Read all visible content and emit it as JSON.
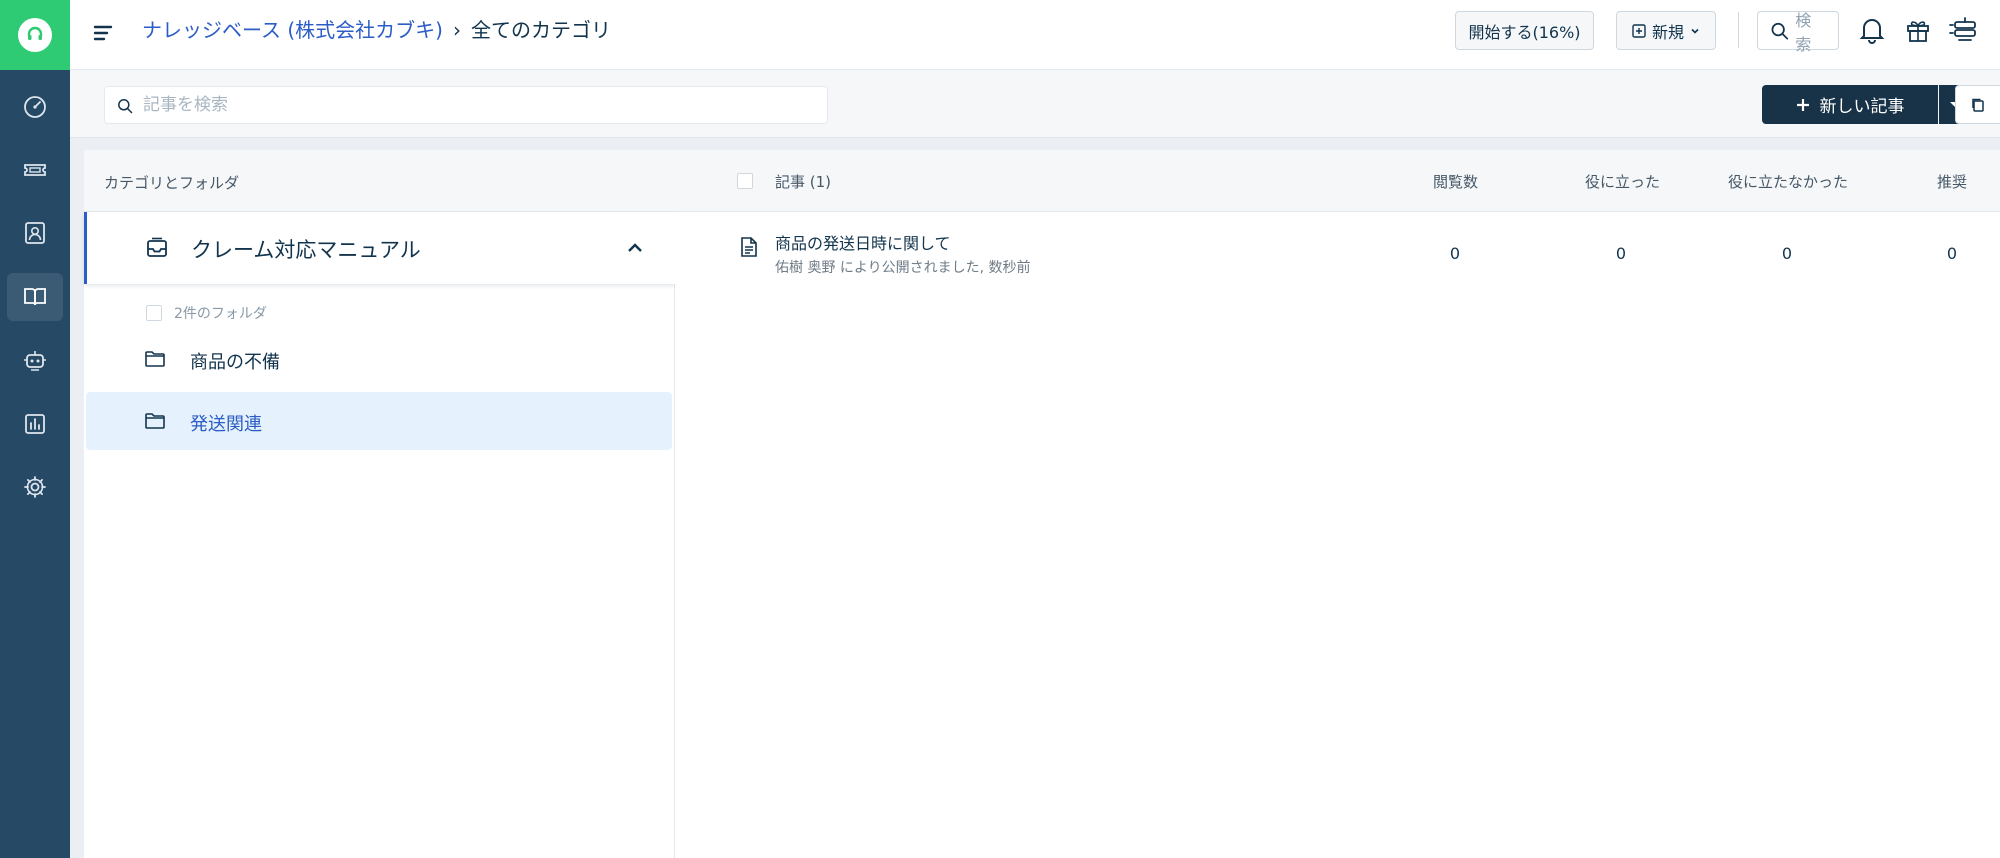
{
  "header": {
    "breadcrumb_root": "ナレッジベース (株式会社カブキ)",
    "breadcrumb_separator": "›",
    "breadcrumb_current": "全てのカテゴリ",
    "start_button": "開始する(16%)",
    "new_button": "新規",
    "search_label": "検索"
  },
  "toolbar": {
    "search_placeholder": "記事を検索",
    "new_article_label": "新しい記事"
  },
  "left_panel": {
    "header": "カテゴリとフォルダ",
    "category": "クレーム対応マニュアル",
    "folder_count": "2件のフォルダ",
    "folders": [
      {
        "label": "商品の不備",
        "selected": false
      },
      {
        "label": "発送関連",
        "selected": true
      }
    ]
  },
  "table": {
    "columns": {
      "article": "記事 (1)",
      "views": "閲覧数",
      "helpful": "役に立った",
      "not_helpful": "役に立たなかった",
      "recommended": "推奨"
    },
    "rows": [
      {
        "title": "商品の発送日時に関して",
        "meta": "佑樹 奥野 により公開されました, 数秒前",
        "views": "0",
        "helpful": "0",
        "not_helpful": "0",
        "recommended": "0"
      }
    ]
  },
  "colors": {
    "rail": "#264966",
    "logo": "#2ecb74",
    "primary_button": "#183247",
    "link": "#2c5cc5",
    "selected_bg": "#e5f2fd"
  }
}
